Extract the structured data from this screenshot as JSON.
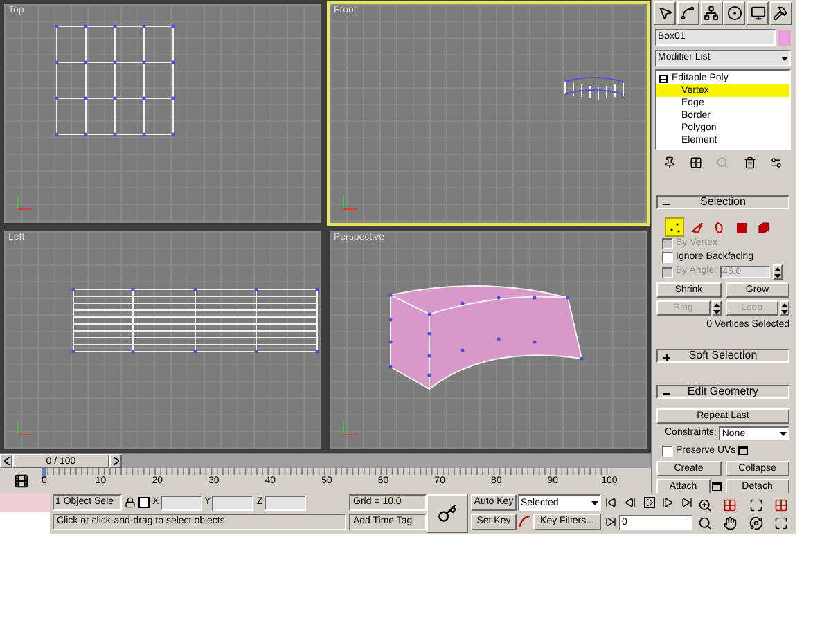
{
  "viewports": [
    {
      "label": "Top",
      "selected": false
    },
    {
      "label": "Front",
      "selected": true
    },
    {
      "label": "Left",
      "selected": false
    },
    {
      "label": "Perspective",
      "selected": false
    }
  ],
  "command_panel": {
    "object_name": "Box01",
    "modifier_list": "Modifier List",
    "stack": {
      "label": "Editable Poly",
      "expanded": true,
      "children": [
        {
          "label": "Vertex",
          "selected": true
        },
        {
          "label": "Edge",
          "selected": false
        },
        {
          "label": "Border",
          "selected": false
        },
        {
          "label": "Polygon",
          "selected": false
        },
        {
          "label": "Element",
          "selected": false
        }
      ]
    },
    "selection": {
      "title": "Selection",
      "expanded": true,
      "subobjects": [
        {
          "kind": "vertex",
          "selected": true
        },
        {
          "kind": "edge",
          "selected": false
        },
        {
          "kind": "border",
          "selected": false
        },
        {
          "kind": "polygon",
          "selected": false
        },
        {
          "kind": "element",
          "selected": false
        }
      ],
      "options": [
        {
          "label": "By Vertex",
          "checked": false,
          "disabled": true
        },
        {
          "label": "Ignore Backfacing",
          "checked": false,
          "disabled": false
        }
      ],
      "by_angle": {
        "label": "By Angle:",
        "value": "45.0",
        "checked": false,
        "disabled": true
      },
      "buttons": [
        {
          "label": "Shrink",
          "disabled": false,
          "spinner": false
        },
        {
          "label": "Grow",
          "disabled": false,
          "spinner": false
        },
        {
          "label": "Ring",
          "disabled": true,
          "spinner": true
        },
        {
          "label": "Loop",
          "disabled": true,
          "spinner": true
        }
      ],
      "status": "0 Vertices Selected"
    },
    "soft_selection": {
      "title": "Soft Selection",
      "expanded": false
    },
    "edit_geometry": {
      "title": "Edit Geometry",
      "expanded": true,
      "repeat_last": "Repeat Last",
      "constraints_label": "Constraints:",
      "constraints_value": "None",
      "preserve_uvs": {
        "label": "Preserve UVs",
        "checked": false
      },
      "buttons": [
        {
          "label": "Create",
          "has_settings": false
        },
        {
          "label": "Collapse",
          "has_settings": false
        },
        {
          "label": "Attach",
          "has_settings": true
        },
        {
          "label": "Detach",
          "has_settings": false
        }
      ]
    }
  },
  "timeline": {
    "slider": "0 / 100",
    "ticks": [
      "0",
      "10",
      "20",
      "30",
      "40",
      "50",
      "60",
      "70",
      "80",
      "90",
      "100"
    ]
  },
  "status_bar": {
    "selection_count": "1 Object Sele",
    "axis_labels": [
      "X",
      "Y",
      "Z"
    ],
    "prompt": "Click or click-and-drag to select objects",
    "grid": "Grid = 10.0",
    "time_tag": "Add Time Tag",
    "auto_key": "Auto Key",
    "key_mode": "Selected",
    "set_key": "Set Key",
    "key_filters": "Key Filters...",
    "frame": "0"
  }
}
